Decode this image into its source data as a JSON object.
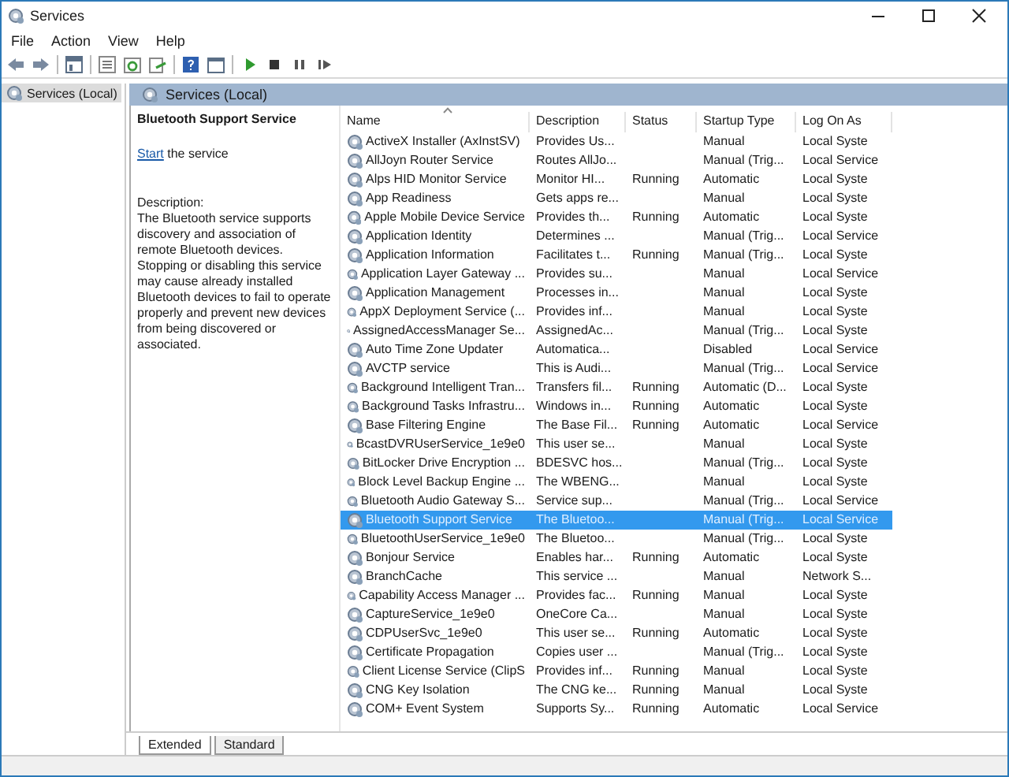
{
  "window": {
    "title": "Services"
  },
  "menu": [
    "File",
    "Action",
    "View",
    "Help"
  ],
  "tree": {
    "items": [
      {
        "label": "Services (Local)",
        "selected": true
      }
    ]
  },
  "header": {
    "title": "Services (Local)"
  },
  "details": {
    "service_name": "Bluetooth Support Service",
    "action_link": "Start",
    "action_text": "the service",
    "description_label": "Description:",
    "description": "The Bluetooth service supports discovery and association of remote Bluetooth devices.  Stopping or disabling this service may cause already installed Bluetooth devices to fail to operate properly and prevent new devices from being discovered or associated."
  },
  "table": {
    "columns": [
      "Name",
      "Description",
      "Status",
      "Startup Type",
      "Log On As"
    ],
    "rows": [
      {
        "cells": [
          "ActiveX Installer (AxInstSV)",
          "Provides Us...",
          "",
          "Manual",
          "Local Syste"
        ],
        "selected": false
      },
      {
        "cells": [
          "AllJoyn Router Service",
          "Routes AllJo...",
          "",
          "Manual (Trig...",
          "Local Service"
        ],
        "selected": false
      },
      {
        "cells": [
          "Alps HID Monitor Service",
          "Monitor HI...",
          "Running",
          "Automatic",
          "Local Syste"
        ],
        "selected": false
      },
      {
        "cells": [
          "App Readiness",
          "Gets apps re...",
          "",
          "Manual",
          "Local Syste"
        ],
        "selected": false
      },
      {
        "cells": [
          "Apple Mobile Device Service",
          "Provides th...",
          "Running",
          "Automatic",
          "Local Syste"
        ],
        "selected": false
      },
      {
        "cells": [
          "Application Identity",
          "Determines ...",
          "",
          "Manual (Trig...",
          "Local Service"
        ],
        "selected": false
      },
      {
        "cells": [
          "Application Information",
          "Facilitates t...",
          "Running",
          "Manual (Trig...",
          "Local Syste"
        ],
        "selected": false
      },
      {
        "cells": [
          "Application Layer Gateway ...",
          "Provides su...",
          "",
          "Manual",
          "Local Service"
        ],
        "selected": false
      },
      {
        "cells": [
          "Application Management",
          "Processes in...",
          "",
          "Manual",
          "Local Syste"
        ],
        "selected": false
      },
      {
        "cells": [
          "AppX Deployment Service (...",
          "Provides inf...",
          "",
          "Manual",
          "Local Syste"
        ],
        "selected": false
      },
      {
        "cells": [
          "AssignedAccessManager Se...",
          "AssignedAc...",
          "",
          "Manual (Trig...",
          "Local Syste"
        ],
        "selected": false
      },
      {
        "cells": [
          "Auto Time Zone Updater",
          "Automatica...",
          "",
          "Disabled",
          "Local Service"
        ],
        "selected": false
      },
      {
        "cells": [
          "AVCTP service",
          "This is Audi...",
          "",
          "Manual (Trig...",
          "Local Service"
        ],
        "selected": false
      },
      {
        "cells": [
          "Background Intelligent Tran...",
          "Transfers fil...",
          "Running",
          "Automatic (D...",
          "Local Syste"
        ],
        "selected": false
      },
      {
        "cells": [
          "Background Tasks Infrastru...",
          "Windows in...",
          "Running",
          "Automatic",
          "Local Syste"
        ],
        "selected": false
      },
      {
        "cells": [
          "Base Filtering Engine",
          "The Base Fil...",
          "Running",
          "Automatic",
          "Local Service"
        ],
        "selected": false
      },
      {
        "cells": [
          "BcastDVRUserService_1e9e0",
          "This user se...",
          "",
          "Manual",
          "Local Syste"
        ],
        "selected": false
      },
      {
        "cells": [
          "BitLocker Drive Encryption ...",
          "BDESVC hos...",
          "",
          "Manual (Trig...",
          "Local Syste"
        ],
        "selected": false
      },
      {
        "cells": [
          "Block Level Backup Engine ...",
          "The WBENG...",
          "",
          "Manual",
          "Local Syste"
        ],
        "selected": false
      },
      {
        "cells": [
          "Bluetooth Audio Gateway S...",
          "Service sup...",
          "",
          "Manual (Trig...",
          "Local Service"
        ],
        "selected": false
      },
      {
        "cells": [
          "Bluetooth Support Service",
          "The Bluetoo...",
          "",
          "Manual (Trig...",
          "Local Service"
        ],
        "selected": true
      },
      {
        "cells": [
          "BluetoothUserService_1e9e0",
          "The Bluetoo...",
          "",
          "Manual (Trig...",
          "Local Syste"
        ],
        "selected": false
      },
      {
        "cells": [
          "Bonjour Service",
          "Enables har...",
          "Running",
          "Automatic",
          "Local Syste"
        ],
        "selected": false
      },
      {
        "cells": [
          "BranchCache",
          "This service ...",
          "",
          "Manual",
          "Network S..."
        ],
        "selected": false
      },
      {
        "cells": [
          "Capability Access Manager ...",
          "Provides fac...",
          "Running",
          "Manual",
          "Local Syste"
        ],
        "selected": false
      },
      {
        "cells": [
          "CaptureService_1e9e0",
          "OneCore Ca...",
          "",
          "Manual",
          "Local Syste"
        ],
        "selected": false
      },
      {
        "cells": [
          "CDPUserSvc_1e9e0",
          "This user se...",
          "Running",
          "Automatic",
          "Local Syste"
        ],
        "selected": false
      },
      {
        "cells": [
          "Certificate Propagation",
          "Copies user ...",
          "",
          "Manual (Trig...",
          "Local Syste"
        ],
        "selected": false
      },
      {
        "cells": [
          "Client License Service (ClipS",
          "Provides inf...",
          "Running",
          "Manual",
          "Local Syste"
        ],
        "selected": false
      },
      {
        "cells": [
          "CNG Key Isolation",
          "The CNG ke...",
          "Running",
          "Manual",
          "Local Syste"
        ],
        "selected": false
      },
      {
        "cells": [
          "COM+ Event System",
          "Supports Sy...",
          "Running",
          "Automatic",
          "Local Service"
        ],
        "selected": false
      }
    ]
  },
  "view_tabs": [
    {
      "label": "Extended",
      "selected": true
    },
    {
      "label": "Standard",
      "selected": false
    }
  ]
}
